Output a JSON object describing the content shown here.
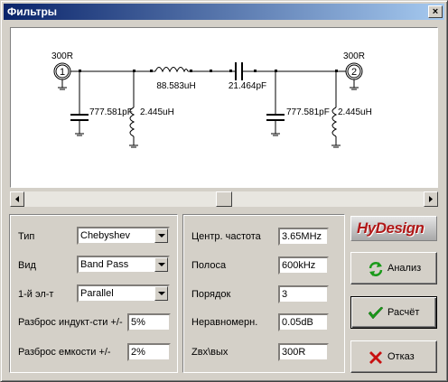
{
  "window": {
    "title": "Фильтры",
    "close_glyph": "×"
  },
  "schematic": {
    "port_in": {
      "number": "1",
      "impedance": "300R"
    },
    "port_out": {
      "number": "2",
      "impedance": "300R"
    },
    "series_inductor": "88.583uH",
    "series_capacitor": "21.464pF",
    "shunt_left_capacitor": "777.581pF",
    "shunt_left_inductor": "2.445uH",
    "shunt_right_capacitor": "777.581pF",
    "shunt_right_inductor": "2.445uH"
  },
  "scrollbar": {
    "position_fraction": 0.5
  },
  "left_panel": {
    "type_label": "Тип",
    "type_value": "Chebyshev",
    "kind_label": "Вид",
    "kind_value": "Band Pass",
    "first_element_label": "1-й эл-т",
    "first_element_value": "Parallel",
    "inductor_tol_label": "Разброс индукт-сти +/-",
    "inductor_tol_value": "5%",
    "capacitor_tol_label": "Разброс емкости +/-",
    "capacitor_tol_value": "2%"
  },
  "mid_panel": {
    "center_freq_label": "Центр. частота",
    "center_freq_value": "3.65MHz",
    "bandwidth_label": "Полоса",
    "bandwidth_value": "600kHz",
    "order_label": "Порядок",
    "order_value": "3",
    "ripple_label": "Неравномерн.",
    "ripple_value": "0.05dB",
    "impedance_label": "Zвх\\вых",
    "impedance_value": "300R"
  },
  "logo": {
    "text": "HyDesign"
  },
  "buttons": {
    "analyze_label": "Анализ",
    "calculate_label": "Расчёт",
    "cancel_label": "Отказ"
  },
  "colors": {
    "title_start": "#0a246a",
    "title_end": "#a6caf0",
    "check_green": "#1a9a1a",
    "cancel_red": "#c81010",
    "logo_red": "#b01818"
  },
  "icons": [
    "close-icon",
    "refresh-icon",
    "check-icon",
    "cancel-x-icon",
    "dropdown-arrow-icon",
    "scroll-left-icon",
    "scroll-right-icon"
  ]
}
